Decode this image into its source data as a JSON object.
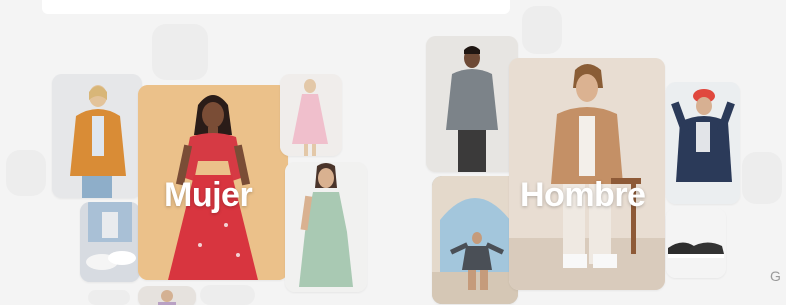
{
  "categories": {
    "women": {
      "label": "Mujer"
    },
    "men": {
      "label": "Hombre"
    }
  },
  "brand_mark": "G"
}
